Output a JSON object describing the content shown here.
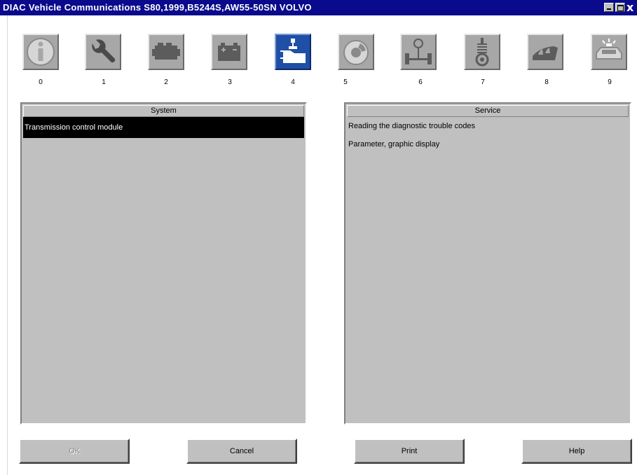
{
  "window": {
    "title": "DIAC  Vehicle Communications S80,1999,B5244S,AW55-50SN VOLVO",
    "close_glyph": "x"
  },
  "toolbar": {
    "items": [
      {
        "number": "0",
        "icon": "info-icon"
      },
      {
        "number": "1",
        "icon": "wrench-icon"
      },
      {
        "number": "2",
        "icon": "engine-icon"
      },
      {
        "number": "3",
        "icon": "battery-icon"
      },
      {
        "number": "4",
        "icon": "transmission-icon",
        "active": true
      },
      {
        "number": "5",
        "icon": "brake-disc-icon"
      },
      {
        "number": "6",
        "icon": "steering-axle-icon"
      },
      {
        "number": "7",
        "icon": "suspension-spring-icon"
      },
      {
        "number": "8",
        "icon": "seat-icon"
      },
      {
        "number": "9",
        "icon": "car-alarm-icon"
      }
    ]
  },
  "system_panel": {
    "header": "System",
    "items": [
      "Transmission control module"
    ]
  },
  "service_panel": {
    "header": "Service",
    "items": [
      "Reading the diagnostic trouble codes",
      "Parameter, graphic display"
    ]
  },
  "buttons": {
    "ok": "OK",
    "cancel": "Cancel",
    "print": "Print",
    "help": "Help"
  },
  "colors": {
    "titlebar": "#0a0a8c",
    "panel": "#c0c0c0",
    "active_icon": "#1f4fa6",
    "selection": "#000000"
  }
}
